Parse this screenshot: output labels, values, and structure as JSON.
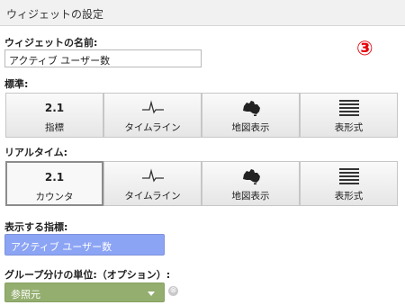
{
  "dialog": {
    "title": "ウィジェットの設定"
  },
  "annotation": {
    "marker": "③",
    "color": "#e5000b"
  },
  "widget_name": {
    "label": "ウィジェットの名前:",
    "value": "アクティブ ユーザー数"
  },
  "standard": {
    "label": "標準:",
    "buttons": [
      {
        "value": "2.1",
        "label": "指標",
        "icon": null,
        "selected": false
      },
      {
        "value": "",
        "label": "タイムライン",
        "icon": "timeline-icon",
        "selected": false
      },
      {
        "value": "",
        "label": "地図表示",
        "icon": "australia-map-icon",
        "selected": false
      },
      {
        "value": "",
        "label": "表形式",
        "icon": "table-icon",
        "selected": false
      }
    ]
  },
  "realtime": {
    "label": "リアルタイム:",
    "buttons": [
      {
        "value": "2.1",
        "label": "カウンタ",
        "icon": null,
        "selected": true
      },
      {
        "value": "",
        "label": "タイムライン",
        "icon": "timeline-icon",
        "selected": false
      },
      {
        "value": "",
        "label": "地図表示",
        "icon": "australia-map-icon",
        "selected": false
      },
      {
        "value": "",
        "label": "表形式",
        "icon": "table-icon",
        "selected": false
      }
    ]
  },
  "metric": {
    "label": "表示する指標:",
    "value": "アクティブ ユーザー数",
    "color": "#8ca4f4"
  },
  "grouping": {
    "label": "グループ分けの単位:（オプション）:",
    "value": "参照元",
    "color": "#93ae6f",
    "clear_icon": "⊗"
  }
}
